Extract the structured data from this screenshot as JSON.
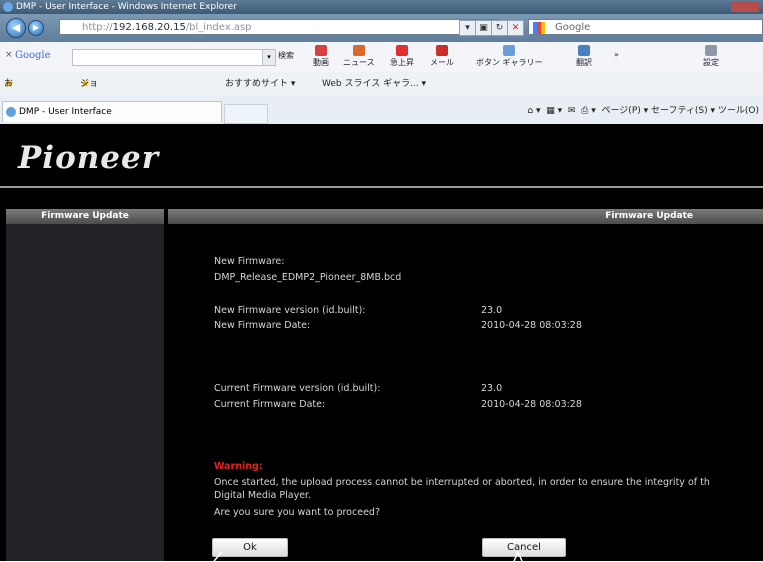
{
  "browser": {
    "window_title": "DMP - User Interface - Windows Internet Explorer",
    "address_scheme": "http://",
    "address_host": "192.168.20.15",
    "address_path": "/bl_index.asp",
    "search_provider": "Google",
    "google_toolbar": {
      "logo": "Google",
      "close": "×",
      "search_btn": "検索",
      "tools": [
        "動画",
        "ニュース",
        "急上昇",
        "メール",
        "ボタン ギャラリー",
        "翻訳",
        "設定"
      ],
      "more": "»"
    },
    "favorites": {
      "label": "お気に入り",
      "items": [
        "ジョルダン株式会社：駅...",
        "おすすめサイト ▾",
        "Web スライス ギャラ... ▾"
      ]
    },
    "tab_title": "DMP - User Interface",
    "command_bar": "ページ(P) ▾   セーフティ(S) ▾   ツール(O)"
  },
  "page": {
    "logo": "Pioneer",
    "sidebar_header": "Firmware Update",
    "main_header": "Firmware Update",
    "new_firmware_label": "New Firmware:",
    "new_firmware_file": "DMP_Release_EDMP2_Pioneer_8MB.bcd",
    "new_version_label": "New Firmware version (id.built):",
    "new_version_value": "23.0",
    "new_date_label": "New Firmware Date:",
    "new_date_value": "2010-04-28  08:03:28",
    "current_version_label": "Current Firmware version (id.built):",
    "current_version_value": "23.0",
    "current_date_label": "Current Firmware Date:",
    "current_date_value": "2010-04-28  08:03:28",
    "warning_title": "Warning:",
    "warning_line1": "Once started, the upload process cannot be interrupted or aborted, in order to ensure the integrity of th",
    "warning_line2": "Digital Media Player.",
    "confirm_question": "Are you sure you want to proceed?",
    "ok_label": "Ok",
    "cancel_label": "Cancel"
  }
}
